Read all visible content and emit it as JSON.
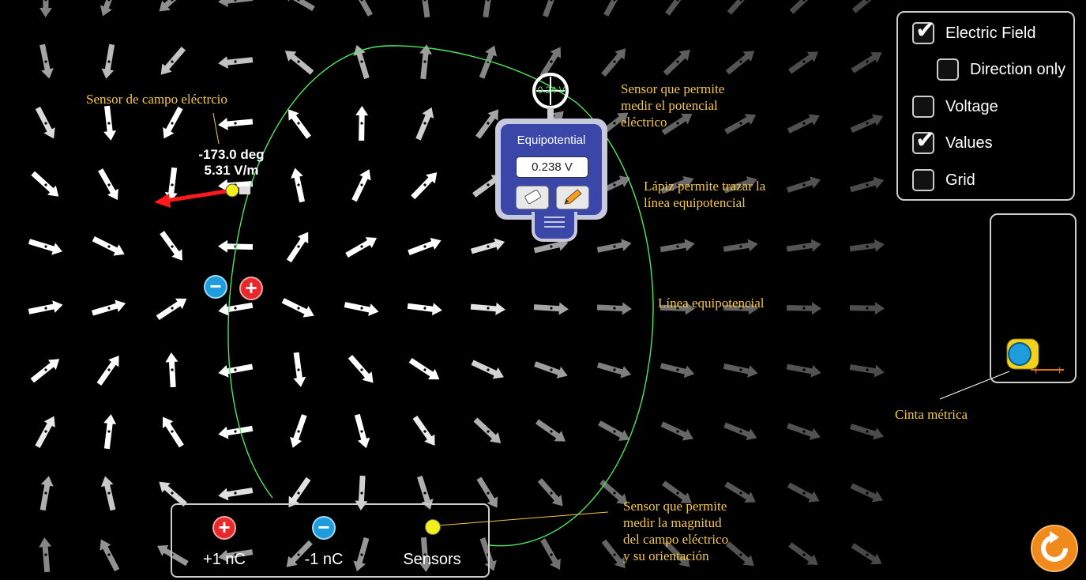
{
  "annotations": {
    "field_sensor": "Sensor de campo eléctrcio",
    "potential_sensor": "Sensor que permite\nmedir el potencial\neléctrico",
    "pencil": "Lápiz permite trazar la\nlínea equipotencial",
    "equipotential_line": "Línea equipotencial",
    "tape": "Cinta métrica",
    "sensor_tool": "Sensor que permite\nmedir la magnitud\ndel campo eléctrico\ny su orientación"
  },
  "field_sensor": {
    "angle": "-173.0 deg",
    "magnitude": "5.31 V/m"
  },
  "equipotential": {
    "title": "Equipotential",
    "value": "0.238 V",
    "crosshair_label": "0.24 V"
  },
  "controls": [
    {
      "label": "Electric Field",
      "checked": true
    },
    {
      "label": "Direction only",
      "checked": false
    },
    {
      "label": "Voltage",
      "checked": false
    },
    {
      "label": "Values",
      "checked": true
    },
    {
      "label": "Grid",
      "checked": false
    }
  ],
  "toolbox": {
    "positive_label": "+1 nC",
    "negative_label": "-1 nC",
    "sensors_label": "Sensors"
  },
  "colors": {
    "annotation": "#f6c744",
    "equipotential_line": "#4be85a",
    "positive": "#e8282b",
    "negative": "#1f9cdc",
    "sensor": "#f2ef1c",
    "field_vector": "#ff1a1a",
    "reset": "#f08a1c"
  },
  "icons": {
    "eraser": "eraser-icon",
    "pencil": "pencil-icon",
    "reset": "reset-icon",
    "tape": "tape-measure-icon"
  }
}
